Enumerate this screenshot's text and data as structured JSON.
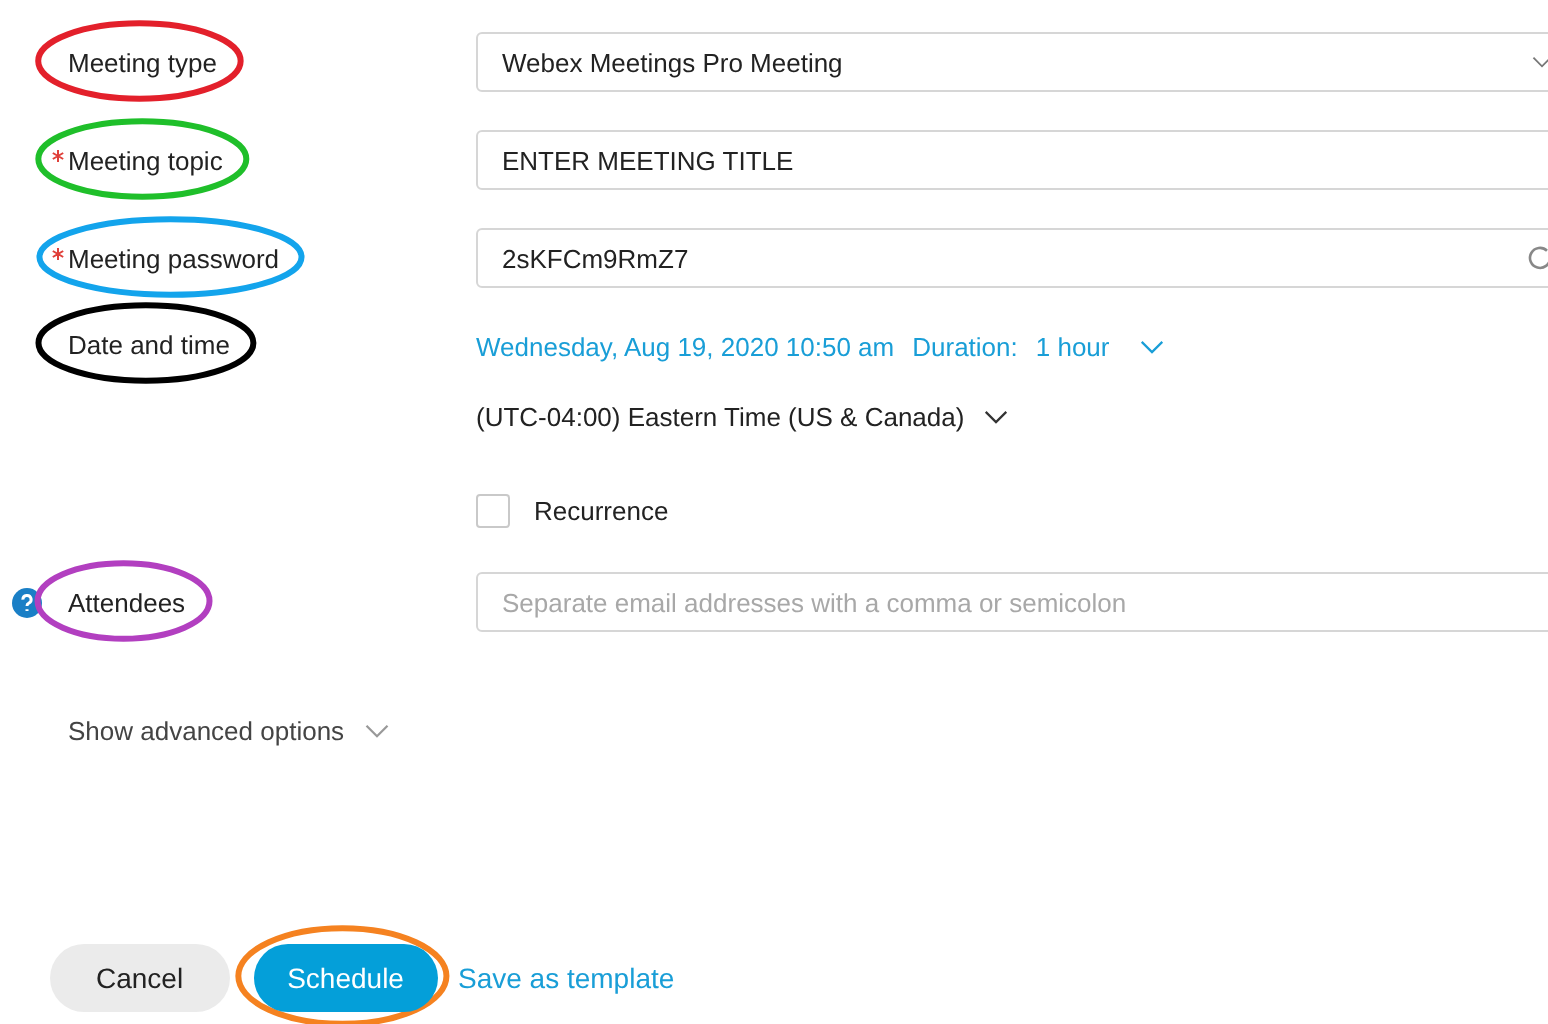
{
  "fields": [
    {
      "kind": "select",
      "label": "Meeting type",
      "required": false,
      "color": "#e3202b",
      "value": "Webex Meetings Pro Meeting"
    },
    {
      "kind": "text",
      "label": "Meeting topic",
      "required": true,
      "color": "#1fbf2a",
      "value": "ENTER MEETING TITLE"
    },
    {
      "kind": "password",
      "label": "Meeting password",
      "required": true,
      "color": "#13a4ec",
      "value": "2sKFCm9RmZ7"
    },
    {
      "kind": "datetime",
      "label": "Date and time",
      "required": false,
      "color": "#000000",
      "date": "Wednesday, Aug 19, 2020 10:50 am",
      "duration_label": "Duration:",
      "duration": "1 hour",
      "timezone": "(UTC-04:00) Eastern Time (US & Canada)",
      "recurrence": {
        "label": "Recurrence",
        "checked": false
      }
    },
    {
      "kind": "email",
      "label": "Attendees",
      "required": false,
      "help": true,
      "color": "#b23fc0",
      "placeholder": "Separate email addresses with a comma or semicolon"
    }
  ],
  "advanced_options": "Show advanced options",
  "buttons": [
    {
      "kind": "secondary",
      "label": "Cancel"
    },
    {
      "kind": "primary",
      "label": "Schedule",
      "color": "#f58220"
    },
    {
      "kind": "link",
      "label": "Save as template"
    }
  ]
}
